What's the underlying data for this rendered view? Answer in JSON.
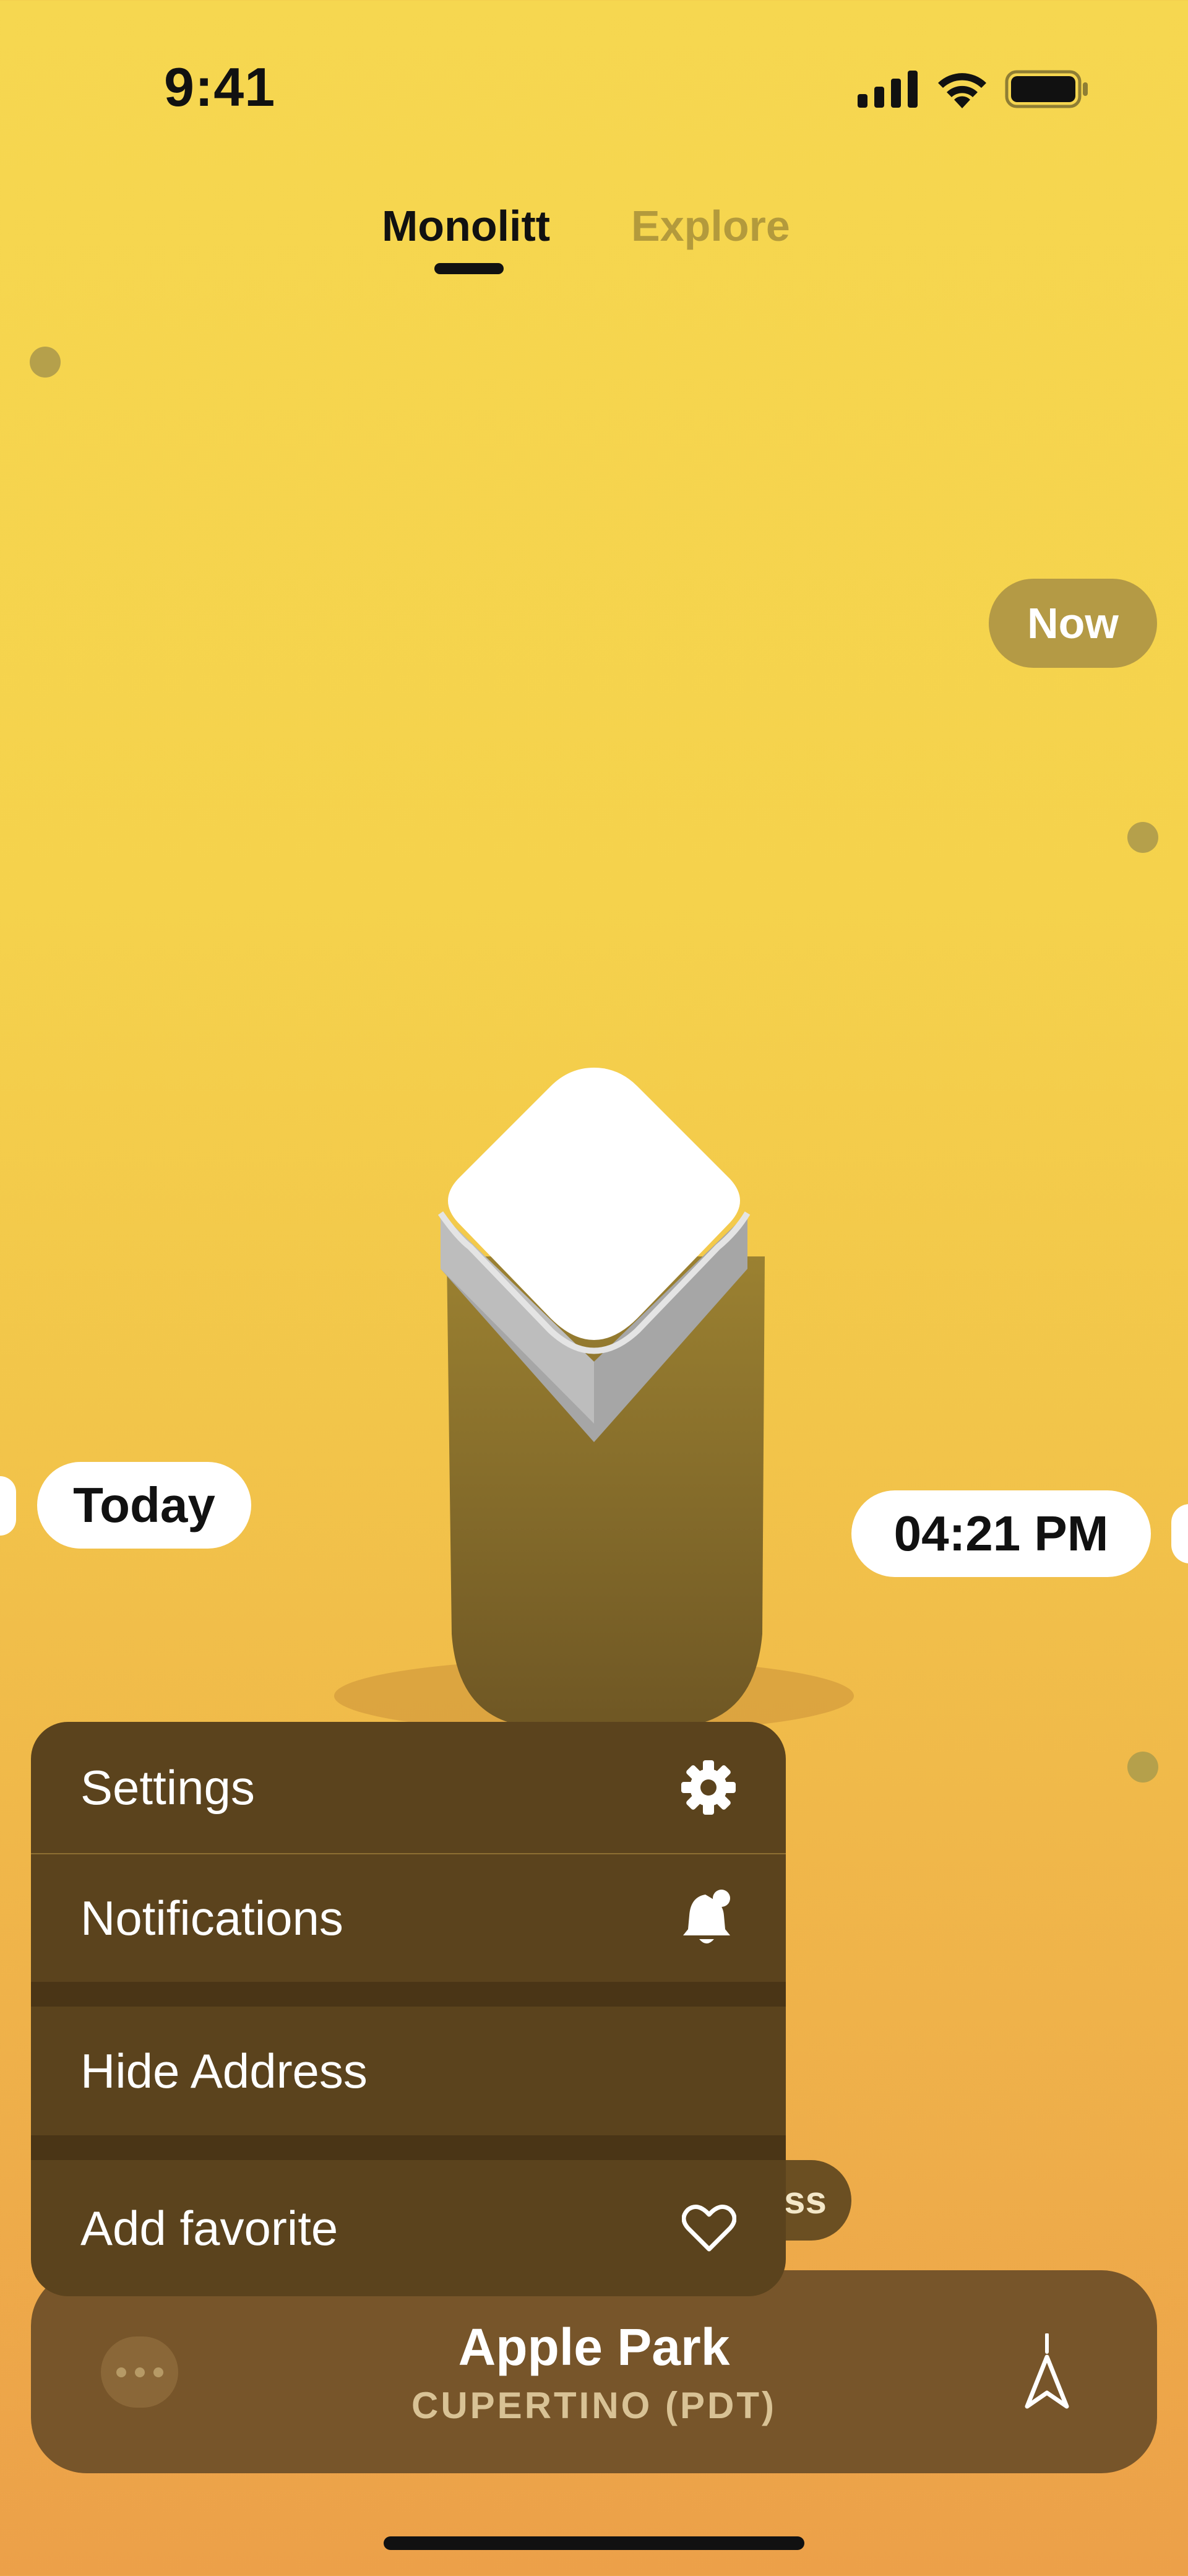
{
  "status_bar": {
    "time": "9:41"
  },
  "tabs": [
    {
      "label": "Monolitt",
      "active": true
    },
    {
      "label": "Explore",
      "active": false
    }
  ],
  "timeline": {
    "now_label": "Now",
    "today_label": "Today",
    "time_label": "04:21 PM",
    "partial_label": "ss"
  },
  "menu": {
    "items": [
      {
        "label": "Settings",
        "icon": "gear-icon"
      },
      {
        "label": "Notifications",
        "icon": "bell-badge-icon"
      },
      {
        "label": "Hide Address",
        "icon": ""
      },
      {
        "label": "Add favorite",
        "icon": "heart-icon"
      }
    ]
  },
  "location": {
    "name": "Apple Park",
    "subtitle": "CUPERTINO (PDT)"
  },
  "colors": {
    "background_top": "#f6d750",
    "background_bottom": "#eca049",
    "menu_bg": "#5b431d",
    "bar_bg": "#77552a",
    "now_pill": "#b49a45"
  }
}
